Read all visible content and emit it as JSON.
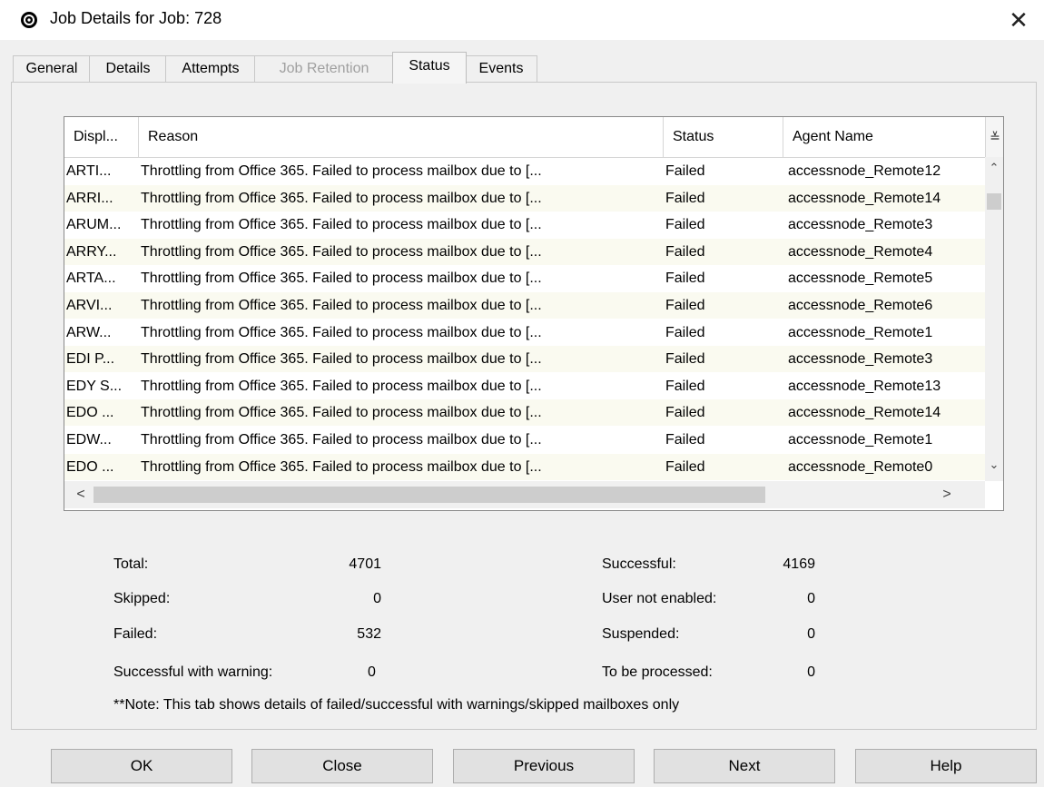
{
  "window": {
    "title": "Job Details for Job: 728",
    "close_glyph": "✕",
    "icon": "commvault-logo-icon"
  },
  "tabs": [
    {
      "label": "General",
      "state": "normal"
    },
    {
      "label": "Details",
      "state": "normal"
    },
    {
      "label": "Attempts",
      "state": "normal"
    },
    {
      "label": "Job Retention",
      "state": "disabled"
    },
    {
      "label": "Status",
      "state": "active"
    },
    {
      "label": "Events",
      "state": "normal"
    }
  ],
  "grid": {
    "columns": [
      "Displ...",
      "Reason",
      "Status",
      "Agent Name"
    ],
    "column_picker_glyph": "≚",
    "rows": [
      {
        "display": "ARTI...",
        "reason": "Throttling from Office 365. Failed to process mailbox due to [...",
        "status": "Failed",
        "agent": "accessnode_Remote12"
      },
      {
        "display": "ARRI...",
        "reason": "Throttling from Office 365. Failed to process mailbox due to [...",
        "status": "Failed",
        "agent": "accessnode_Remote14"
      },
      {
        "display": "ARUM...",
        "reason": "Throttling from Office 365. Failed to process mailbox due to [...",
        "status": "Failed",
        "agent": "accessnode_Remote3"
      },
      {
        "display": "ARRY...",
        "reason": "Throttling from Office 365. Failed to process mailbox due to [...",
        "status": "Failed",
        "agent": "accessnode_Remote4"
      },
      {
        "display": "ARTA...",
        "reason": "Throttling from Office 365. Failed to process mailbox due to [...",
        "status": "Failed",
        "agent": "accessnode_Remote5"
      },
      {
        "display": "ARVI...",
        "reason": "Throttling from Office 365. Failed to process mailbox due to [...",
        "status": "Failed",
        "agent": "accessnode_Remote6"
      },
      {
        "display": "ARW...",
        "reason": "Throttling from Office 365. Failed to process mailbox due to [...",
        "status": "Failed",
        "agent": "accessnode_Remote1"
      },
      {
        "display": "EDI P...",
        "reason": "Throttling from Office 365. Failed to process mailbox due to [...",
        "status": "Failed",
        "agent": "accessnode_Remote3"
      },
      {
        "display": "EDY S...",
        "reason": "Throttling from Office 365. Failed to process mailbox due to [...",
        "status": "Failed",
        "agent": "accessnode_Remote13"
      },
      {
        "display": "EDO ...",
        "reason": "Throttling from Office 365. Failed to process mailbox due to [...",
        "status": "Failed",
        "agent": "accessnode_Remote14"
      },
      {
        "display": "EDW...",
        "reason": "Throttling from Office 365. Failed to process mailbox due to [...",
        "status": "Failed",
        "agent": "accessnode_Remote1"
      },
      {
        "display": "EDO ...",
        "reason": "Throttling from Office 365. Failed to process mailbox due to [...",
        "status": "Failed",
        "agent": "accessnode_Remote0"
      }
    ],
    "scroll": {
      "up": "⌃",
      "down": "⌄",
      "left": "<",
      "right": ">"
    }
  },
  "stats_left": [
    {
      "label": "Total:",
      "value": "4701"
    },
    {
      "label": "Skipped:",
      "value": "0"
    },
    {
      "label": "Failed:",
      "value": "532"
    },
    {
      "label": "Successful with warning:",
      "value": "0"
    }
  ],
  "stats_right": [
    {
      "label": "Successful:",
      "value": "4169"
    },
    {
      "label": "User not enabled:",
      "value": "0"
    },
    {
      "label": "Suspended:",
      "value": "0"
    },
    {
      "label": "To be processed:",
      "value": "0"
    }
  ],
  "note": "**Note: This tab shows details of failed/successful with warnings/skipped mailboxes only",
  "buttons": [
    {
      "label": "OK"
    },
    {
      "label": "Close"
    },
    {
      "label": "Previous"
    },
    {
      "label": "Next"
    },
    {
      "label": "Help"
    }
  ]
}
